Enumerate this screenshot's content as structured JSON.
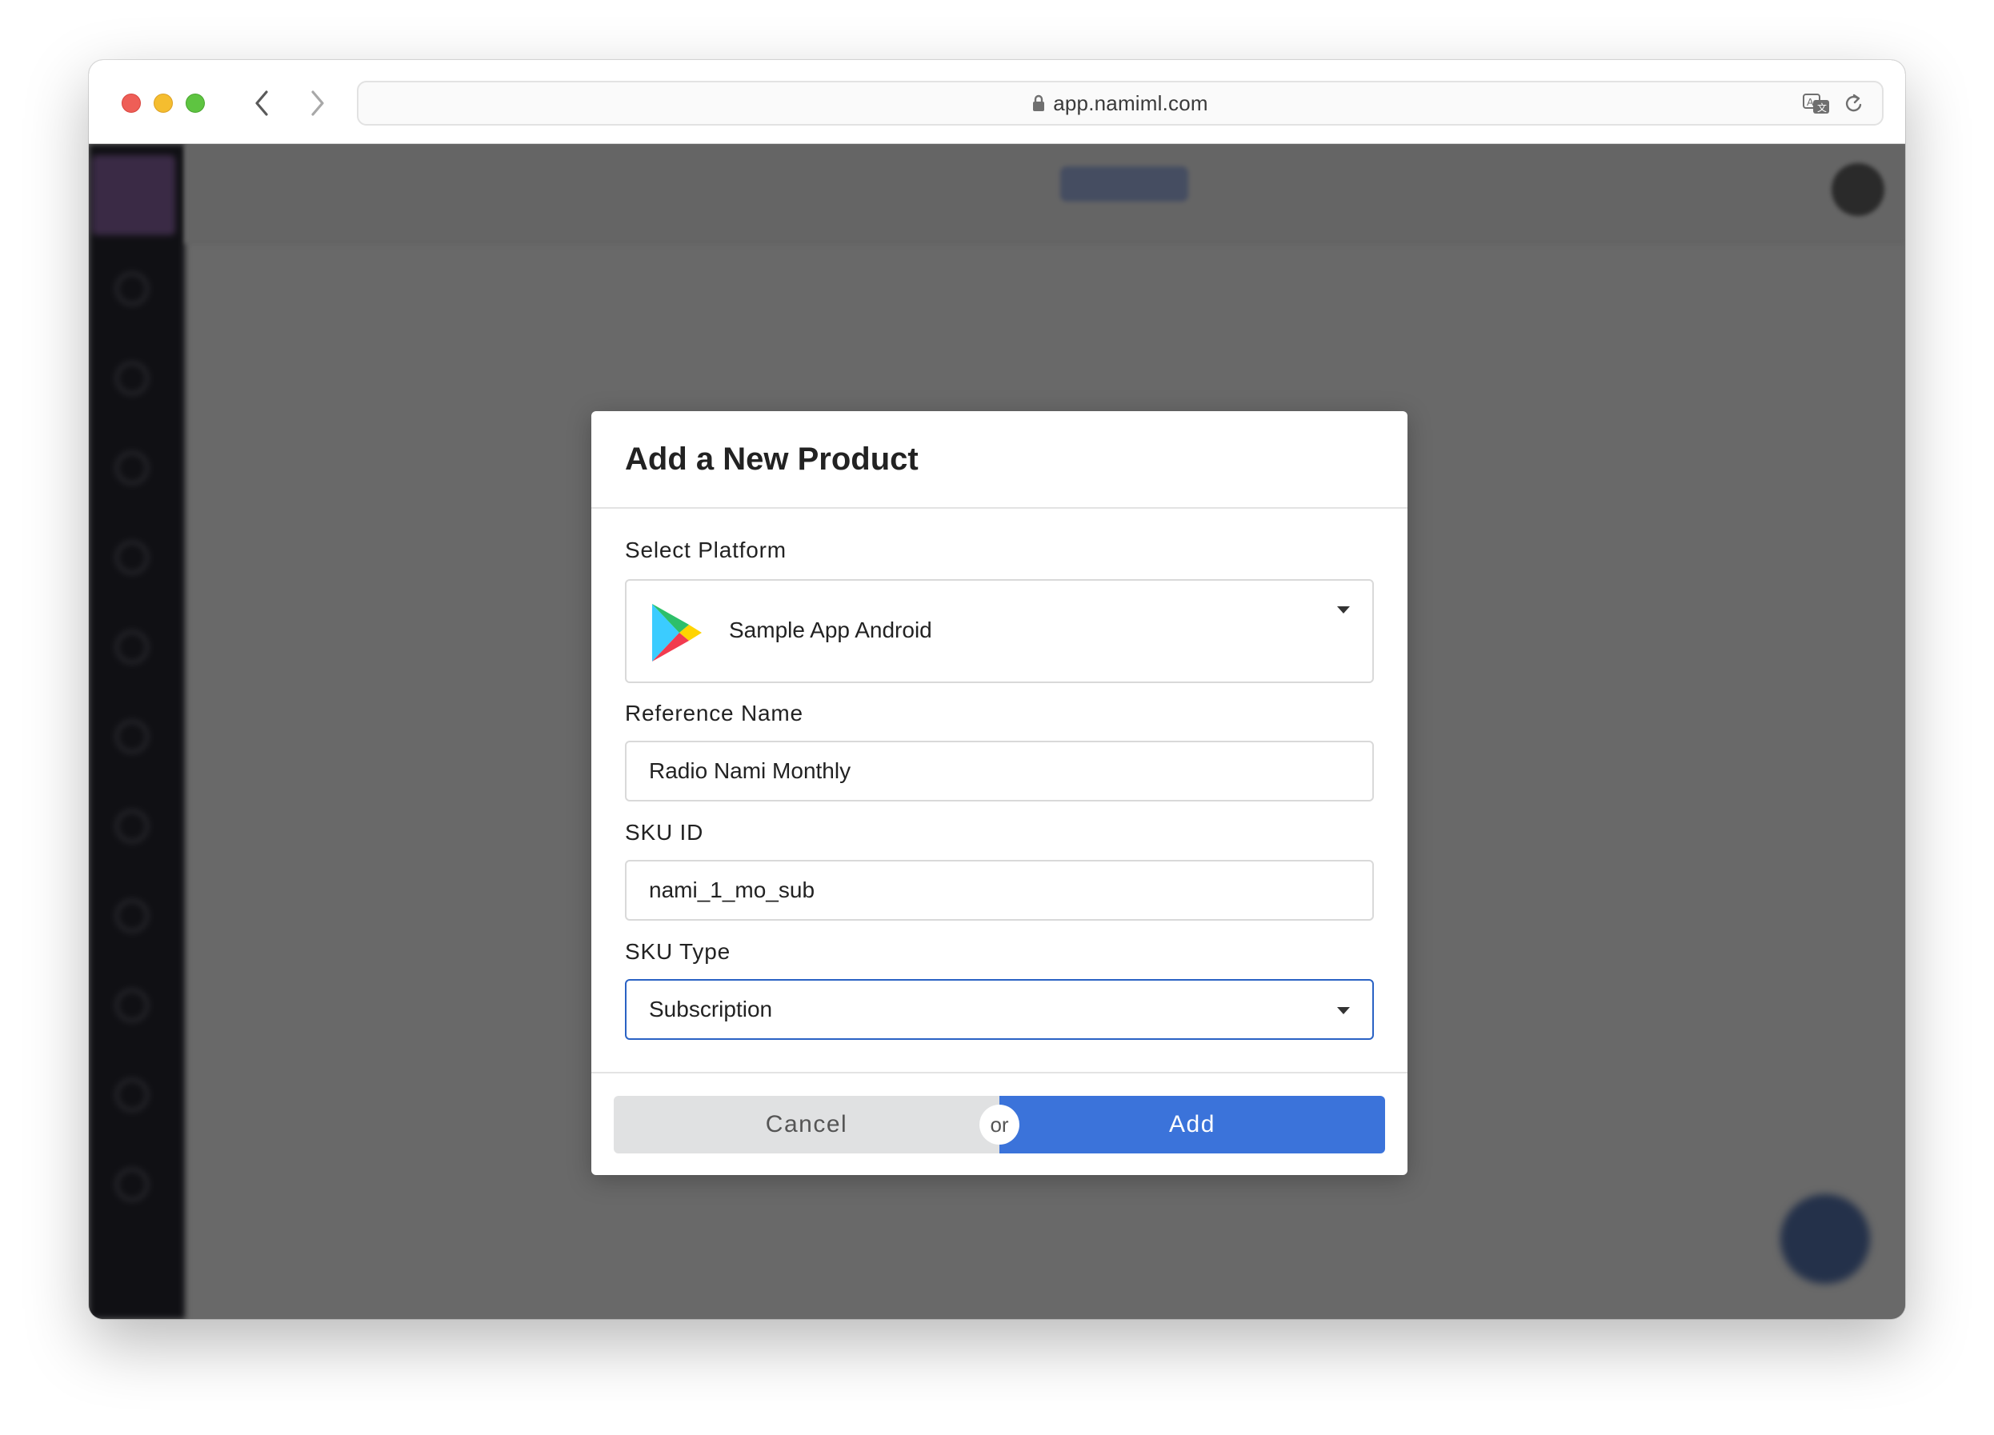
{
  "browser": {
    "url": "app.namiml.com"
  },
  "modal": {
    "title": "Add a New Product",
    "platform": {
      "label": "Select Platform",
      "value": "Sample App Android",
      "icon": "google-play-icon"
    },
    "reference_name": {
      "label": "Reference Name",
      "value": "Radio Nami Monthly"
    },
    "sku_id": {
      "label": "SKU ID",
      "value": "nami_1_mo_sub"
    },
    "sku_type": {
      "label": "SKU Type",
      "value": "Subscription"
    },
    "footer": {
      "cancel_label": "Cancel",
      "or_label": "or",
      "add_label": "Add"
    }
  },
  "colors": {
    "primary": "#3b73da",
    "focus_border": "#2a62c4",
    "overlay": "#696969"
  }
}
